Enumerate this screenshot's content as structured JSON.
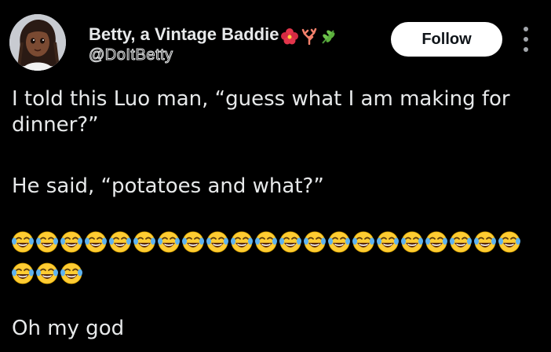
{
  "author": {
    "display_name": "Betty, a Vintage Baddie",
    "name_emojis": [
      "hibiscus-icon",
      "coral-icon",
      "herb-icon"
    ],
    "handle": "@DoItBetty"
  },
  "follow_label": "Follow",
  "tweet": {
    "line1": "I told this Luo man, “guess what I am making for dinner?”",
    "line2": "He said, “potatoes and what?”",
    "emoji_name": "face-with-tears-of-joy-icon",
    "emoji_count": 24,
    "line3": "Oh my god"
  },
  "colors": {
    "background": "#000000",
    "text": "#e7e9ea",
    "follow_bg": "#ffffff"
  }
}
